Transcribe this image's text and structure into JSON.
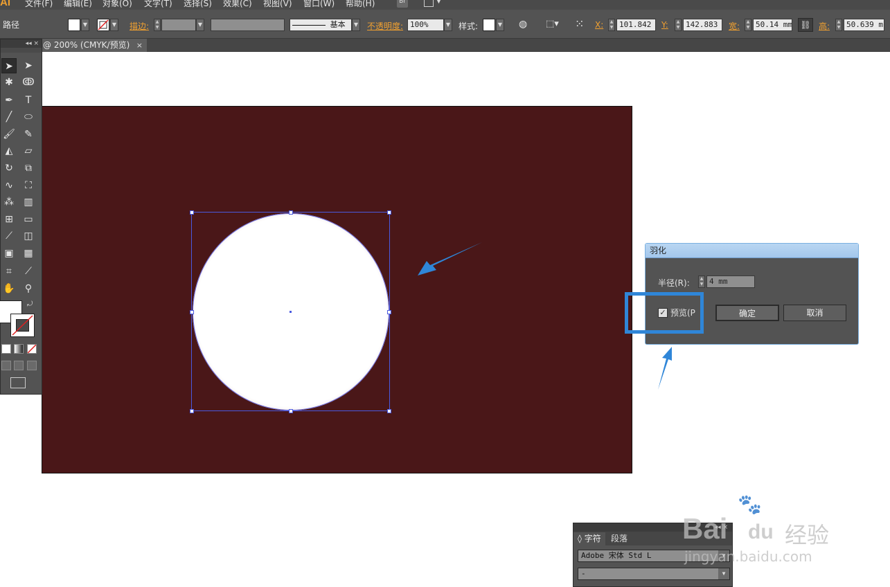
{
  "app": {
    "logo": "AI"
  },
  "menu": {
    "items": [
      "文件(F)",
      "编辑(E)",
      "对象(O)",
      "文字(T)",
      "选择(S)",
      "效果(C)",
      "视图(V)",
      "窗口(W)",
      "帮助(H)"
    ],
    "bridge_label": "Br"
  },
  "control_bar": {
    "selection_type": "路径",
    "stroke_label": "描边:",
    "stroke_profile": "基本",
    "opacity_label": "不透明度:",
    "opacity_value": "100%",
    "style_label": "样式:",
    "x_label": "X:",
    "x_value": "101.842 I",
    "y_label": "Y:",
    "y_value": "142.883 I",
    "w_label": "宽:",
    "w_value": "50.14 mm",
    "h_label": "高:",
    "h_value": "50.639 m"
  },
  "document_tab": {
    "title": "@ 200% (CMYK/预览)",
    "close": "×"
  },
  "colors": {
    "artboard": "#4a1718",
    "ui_dark": "#535353",
    "accent_orange": "#f0a030",
    "highlight_blue": "#2f86d8",
    "selection_blue": "#4a5ae0"
  },
  "toolbox": {
    "collapse": "◂◂ ×",
    "tools": [
      "selection-tool",
      "direct-selection-tool",
      "magic-wand-tool",
      "lasso-tool",
      "pen-tool",
      "type-tool",
      "line-tool",
      "ellipse-tool",
      "paintbrush-tool",
      "pencil-tool",
      "blob-brush-tool",
      "eraser-tool",
      "rotate-tool",
      "scale-tool",
      "warp-tool",
      "free-transform-tool",
      "symbol-sprayer-tool",
      "column-graph-tool",
      "mesh-tool",
      "gradient-tool",
      "eyedropper-tool",
      "blend-tool",
      "live-paint-tool",
      "live-paint-selection-tool",
      "artboard-tool",
      "slice-tool",
      "hand-tool",
      "zoom-tool"
    ]
  },
  "feather_dialog": {
    "title": "羽化",
    "radius_label": "半径(R):",
    "radius_value": "4 mm",
    "preview_label": "预览(P",
    "preview_checked": true,
    "ok_label": "确定",
    "cancel_label": "取消"
  },
  "character_panel": {
    "collapse": "◂◂ ×",
    "tab_character": "字符",
    "tab_paragraph": "段落",
    "font_family": "Adobe 宋体 Std L",
    "font_style": "-"
  },
  "watermark": {
    "brand": "Bai",
    "paw": "du",
    "cn": "经验",
    "url": "jingyan.baidu.com"
  }
}
